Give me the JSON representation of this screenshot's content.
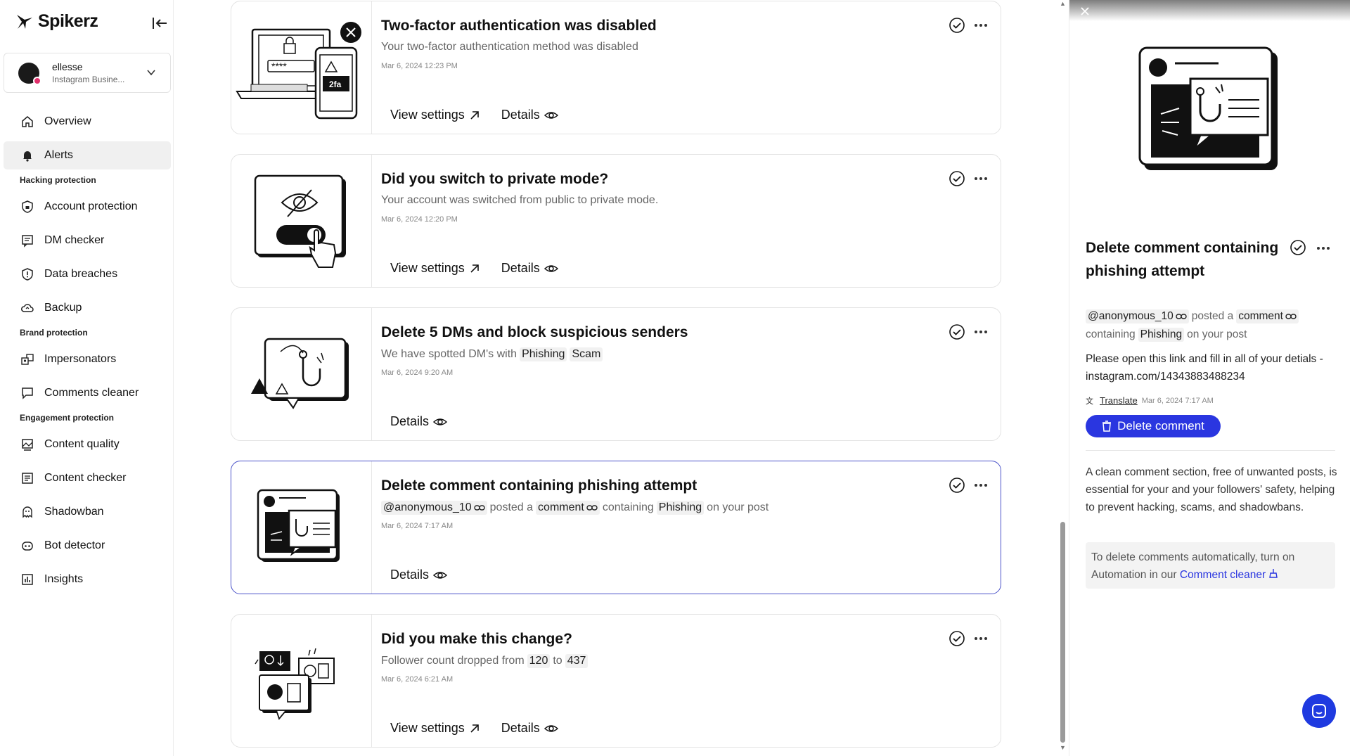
{
  "app": {
    "name": "Spikerz"
  },
  "account": {
    "name": "ellesse",
    "type": "Instagram Busine..."
  },
  "nav": {
    "overview": "Overview",
    "alerts": "Alerts",
    "sec_hacking": "Hacking protection",
    "account_protection": "Account protection",
    "dm_checker": "DM checker",
    "data_breaches": "Data breaches",
    "backup": "Backup",
    "sec_brand": "Brand protection",
    "impersonators": "Impersonators",
    "comments_cleaner": "Comments cleaner",
    "sec_engagement": "Engagement protection",
    "content_quality": "Content quality",
    "content_checker": "Content checker",
    "shadowban": "Shadowban",
    "bot_detector": "Bot detector",
    "insights": "Insights"
  },
  "alerts": [
    {
      "title": "Two-factor authentication was disabled",
      "desc": "Your two-factor authentication method was disabled",
      "date": "Mar 6, 2024 12:23 PM",
      "view_settings": "View settings",
      "details": "Details",
      "ill_label": "2fa"
    },
    {
      "title": "Did you switch to private mode?",
      "desc": "Your account was switched from public to private mode.",
      "date": "Mar 6, 2024 12:20 PM",
      "view_settings": "View settings",
      "details": "Details"
    },
    {
      "title": "Delete 5 DMs and block suspicious senders",
      "desc_prefix": "We have spotted DM's with",
      "tag1": "Phishing",
      "tag2": "Scam",
      "date": "Mar 6, 2024 9:20 AM",
      "details": "Details"
    },
    {
      "title": "Delete comment containing phishing attempt",
      "user": "@anonymous_10",
      "posted": "posted a",
      "comment": "comment",
      "containing": "containing",
      "tag": "Phishing",
      "suffix": "on your post",
      "date": "Mar 6, 2024 7:17 AM",
      "details": "Details"
    },
    {
      "title": "Did you make this change?",
      "desc_prefix": "Follower count dropped from",
      "from": "120",
      "to_word": "to",
      "to": "437",
      "date": "Mar 6, 2024 6:21 AM",
      "view_settings": "View settings",
      "details": "Details"
    }
  ],
  "panel": {
    "title": "Delete comment containing phishing attempt",
    "user": "@anonymous_10",
    "posted": "posted a",
    "comment": "comment",
    "containing": "containing",
    "tag": "Phishing",
    "suffix": "on your post",
    "message": "Please open this link and fill in all of your detials - instagram.com/14343883488234",
    "translate": "Translate",
    "date": "Mar 6, 2024 7:17 AM",
    "button": "Delete comment",
    "info": "A clean comment section, free of unwanted posts, is essential for your and your followers' safety, helping to prevent hacking, scams, and shadowbans.",
    "note_text": "To delete comments automatically, turn on Automation in our",
    "note_link": "Comment cleaner"
  },
  "colors": {
    "accent": "#2a36e0",
    "selected_border": "#4a52c9"
  }
}
